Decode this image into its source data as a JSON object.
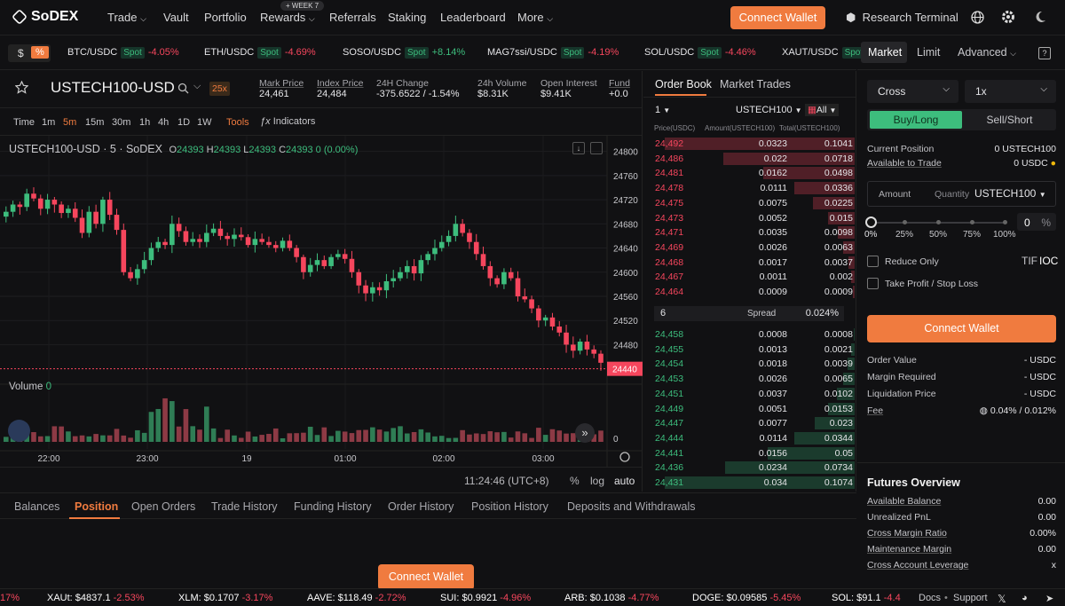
{
  "brand": {
    "name": "SoDEX"
  },
  "nav": {
    "trade": "Trade",
    "vault": "Vault",
    "portfolio": "Portfolio",
    "rewards": "Rewards",
    "rewards_badge": "+ WEEK 7",
    "referrals": "Referrals",
    "staking": "Staking",
    "leaderboard": "Leaderboard",
    "more": "More",
    "connect": "Connect Wallet",
    "research": "Research Terminal"
  },
  "ticker": {
    "toggle_dollar": "$",
    "toggle_pct": "%",
    "items": [
      {
        "sym": "BTC/USDC",
        "tag": "Spot",
        "chg": "-4.05%"
      },
      {
        "sym": "ETH/USDC",
        "tag": "Spot",
        "chg": "-4.69%"
      },
      {
        "sym": "SOSO/USDC",
        "tag": "Spot",
        "chg": "+8.14%"
      },
      {
        "sym": "MAG7ssi/USDC",
        "tag": "Spot",
        "chg": "-4.19%"
      },
      {
        "sym": "SOL/USDC",
        "tag": "Spot",
        "chg": "-4.46%"
      },
      {
        "sym": "XAUT/USDC",
        "tag": "Spot",
        "chg": ""
      }
    ]
  },
  "market": {
    "symbol": "USTECH100-USD",
    "leverage": "25x",
    "mark_label": "Mark Price",
    "mark": "24,461",
    "index_label": "Index Price",
    "index": "24,484",
    "change_label": "24H Change",
    "change": "-375.6522 / -1.54%",
    "volume_label": "24h Volume",
    "volume": "$8.31K",
    "oi_label": "Open Interest",
    "oi": "$9.41K",
    "funding_label": "Fund",
    "funding": "+0.0"
  },
  "chart_toolbar": {
    "time": "Time",
    "intervals": [
      "1m",
      "5m",
      "15m",
      "30m",
      "1h",
      "4h",
      "1D",
      "1W"
    ],
    "active": "5m",
    "tools": "Tools",
    "indicators": "Indicators"
  },
  "chart_legend": {
    "title": "USTECH100-USD · 5 · SoDEX",
    "o_label": "O",
    "o": "24393",
    "h_label": "H",
    "h": "24393",
    "l_label": "L",
    "l": "24393",
    "c_label": "C",
    "c": "24393",
    "chg": "0 (0.00%)",
    "volume_label": "Volume",
    "volume": "0"
  },
  "chart_footer": {
    "clock": "11:24:46 (UTC+8)",
    "pct": "%",
    "log": "log",
    "auto": "auto"
  },
  "chart_data": {
    "type": "candlestick",
    "title": "USTECH100-USD · 5 · SoDEX",
    "y_ticks": [
      24800,
      24760,
      24720,
      24680,
      24640,
      24600,
      24560,
      24520,
      24480
    ],
    "ylim": [
      24416,
      24820
    ],
    "x_ticks": [
      "22:00",
      "23:00",
      "19",
      "01:00",
      "02:00",
      "03:00"
    ],
    "last_price": "24440",
    "volume_axis": "0",
    "closes": [
      24700,
      24712,
      24708,
      24730,
      24722,
      24705,
      24720,
      24712,
      24698,
      24705,
      24690,
      24665,
      24700,
      24680,
      24720,
      24695,
      24670,
      24600,
      24590,
      24605,
      24620,
      24640,
      24650,
      24645,
      24680,
      24668,
      24650,
      24655,
      24650,
      24665,
      24672,
      24660,
      24655,
      24662,
      24658,
      24645,
      24655,
      24650,
      24645,
      24640,
      24652,
      24640,
      24625,
      24600,
      24612,
      24620,
      24610,
      24625,
      24630,
      24622,
      24600,
      24578,
      24565,
      24575,
      24570,
      24585,
      24590,
      24600,
      24610,
      24598,
      24620,
      24630,
      24640,
      24650,
      24660,
      24680,
      24665,
      24650,
      24630,
      24610,
      24590,
      24580,
      24600,
      24590,
      24560,
      24555,
      24540,
      24520,
      24525,
      24510,
      24500,
      24480,
      24470,
      24485,
      24472,
      24465,
      24450
    ]
  },
  "orderbook": {
    "tab_book": "Order Book",
    "tab_trades": "Market Trades",
    "depth": "1",
    "symbol": "USTECH100",
    "filter": "All",
    "h_price": "Price(USDC)",
    "h_amount": "Amount(USTECH100)",
    "h_total": "Total(USTECH100)",
    "asks": [
      {
        "p": "24,492",
        "a": "0.0323",
        "t": "0.1041",
        "d": 1.0
      },
      {
        "p": "24,486",
        "a": "0.022",
        "t": "0.0718",
        "d": 0.69
      },
      {
        "p": "24,481",
        "a": "0.0162",
        "t": "0.0498",
        "d": 0.48
      },
      {
        "p": "24,478",
        "a": "0.0111",
        "t": "0.0336",
        "d": 0.32
      },
      {
        "p": "24,475",
        "a": "0.0075",
        "t": "0.0225",
        "d": 0.22
      },
      {
        "p": "24,473",
        "a": "0.0052",
        "t": "0.015",
        "d": 0.14
      },
      {
        "p": "24,471",
        "a": "0.0035",
        "t": "0.0098",
        "d": 0.09
      },
      {
        "p": "24,469",
        "a": "0.0026",
        "t": "0.0063",
        "d": 0.06
      },
      {
        "p": "24,468",
        "a": "0.0017",
        "t": "0.0037",
        "d": 0.035
      },
      {
        "p": "24,467",
        "a": "0.0011",
        "t": "0.002",
        "d": 0.02
      },
      {
        "p": "24,464",
        "a": "0.0009",
        "t": "0.0009",
        "d": 0.01
      }
    ],
    "spread_n": "6",
    "spread_label": "Spread",
    "spread": "0.024%",
    "bids": [
      {
        "p": "24,458",
        "a": "0.0008",
        "t": "0.0008",
        "d": 0.007
      },
      {
        "p": "24,455",
        "a": "0.0013",
        "t": "0.0021",
        "d": 0.02
      },
      {
        "p": "24,454",
        "a": "0.0018",
        "t": "0.0039",
        "d": 0.036
      },
      {
        "p": "24,453",
        "a": "0.0026",
        "t": "0.0065",
        "d": 0.06
      },
      {
        "p": "24,451",
        "a": "0.0037",
        "t": "0.0102",
        "d": 0.095
      },
      {
        "p": "24,449",
        "a": "0.0051",
        "t": "0.0153",
        "d": 0.14
      },
      {
        "p": "24,447",
        "a": "0.0077",
        "t": "0.023",
        "d": 0.21
      },
      {
        "p": "24,444",
        "a": "0.0114",
        "t": "0.0344",
        "d": 0.32
      },
      {
        "p": "24,441",
        "a": "0.0156",
        "t": "0.05",
        "d": 0.46
      },
      {
        "p": "24,436",
        "a": "0.0234",
        "t": "0.0734",
        "d": 0.68
      },
      {
        "p": "24,431",
        "a": "0.034",
        "t": "0.1074",
        "d": 1.0
      }
    ]
  },
  "trade": {
    "tab_market": "Market",
    "tab_limit": "Limit",
    "tab_adv": "Advanced",
    "margin": "Cross",
    "lev": "1x",
    "buy": "Buy/Long",
    "sell": "Sell/Short",
    "cur_pos_label": "Current Position",
    "cur_pos": "0 USTECH100",
    "avail_label": "Available to Trade",
    "avail": "0 USDC",
    "amount_label": "Amount",
    "qty_label": "Quantity",
    "qty_sym": "USTECH100",
    "pct_val": "0",
    "pct_sign": "%",
    "marks": [
      "0%",
      "25%",
      "50%",
      "75%",
      "100%"
    ],
    "slider_level": 0,
    "reduce": "Reduce Only",
    "tif_label": "TIF",
    "tif": "IOC",
    "tpsl": "Take Profit / Stop Loss",
    "connect": "Connect Wallet",
    "order_value_label": "Order Value",
    "order_value": "- USDC",
    "margin_req_label": "Margin Required",
    "margin_req": "- USDC",
    "liq_label": "Liquidation Price",
    "liq": "- USDC",
    "fee_label": "Fee",
    "fee": "0.04% / 0.012%"
  },
  "futures": {
    "title": "Futures Overview",
    "rows": [
      {
        "l": "Available Balance",
        "v": "0.00"
      },
      {
        "l": "Unrealized PnL",
        "v": "0.00"
      },
      {
        "l": "Cross Margin Ratio",
        "v": "0.00%"
      },
      {
        "l": "Maintenance Margin",
        "v": "0.00"
      },
      {
        "l": "Cross Account Leverage",
        "v": "x"
      }
    ]
  },
  "bottom_tabs": [
    "Balances",
    "Position",
    "Open Orders",
    "Trade History",
    "Funding History",
    "Order History",
    "Position History",
    "Deposits and Withdrawals"
  ],
  "bottom_connect": "Connect Wallet",
  "bottom_ticker": [
    {
      "s": "",
      "p": "",
      "c": "17%"
    },
    {
      "s": "XAUt:",
      "p": "$4837.1",
      "c": "-2.53%"
    },
    {
      "s": "XLM:",
      "p": "$0.1707",
      "c": "-3.17%"
    },
    {
      "s": "AAVE:",
      "p": "$118.49",
      "c": "-2.72%"
    },
    {
      "s": "SUI:",
      "p": "$0.9921",
      "c": "-4.96%"
    },
    {
      "s": "ARB:",
      "p": "$0.1038",
      "c": "-4.77%"
    },
    {
      "s": "DOGE:",
      "p": "$0.09585",
      "c": "-5.45%"
    },
    {
      "s": "SOL:",
      "p": "$91.1",
      "c": "-4.4"
    }
  ],
  "footer": {
    "docs": "Docs",
    "support": "Support"
  }
}
